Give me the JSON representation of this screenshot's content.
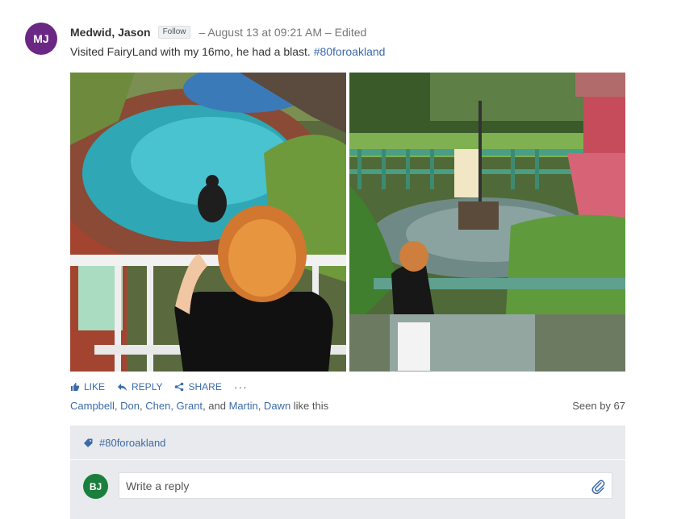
{
  "post": {
    "author_initials": "MJ",
    "author_name": "Medwid, Jason",
    "follow_label": "Follow",
    "meta": "– August 13 at 09:21 AM – Edited",
    "text": "Visited FairyLand with my 16mo, he had a blast. ",
    "hashtag": "#80foroakland"
  },
  "photos": [
    {
      "name": "photo-child-at-fountain"
    },
    {
      "name": "photo-child-at-pond"
    }
  ],
  "actions": {
    "like": "LIKE",
    "reply": "REPLY",
    "share": "SHARE",
    "more": "···"
  },
  "likes": {
    "names": [
      "Campbell, Don",
      "Chen, Grant",
      "Martin, Dawn"
    ],
    "sep1": ", ",
    "sep2": ", and ",
    "suffix": " like this"
  },
  "seen_by": "Seen by 67",
  "topic": {
    "label": "#80foroakland",
    "icon": "tag-icon"
  },
  "reply": {
    "initials": "BJ",
    "placeholder": "Write a reply",
    "attach_icon": "paperclip-icon"
  },
  "colors": {
    "author_avatar": "#6b2784",
    "reply_avatar": "#1a7f3c",
    "link": "#3b6aa8",
    "panel": "#e9eaed"
  }
}
